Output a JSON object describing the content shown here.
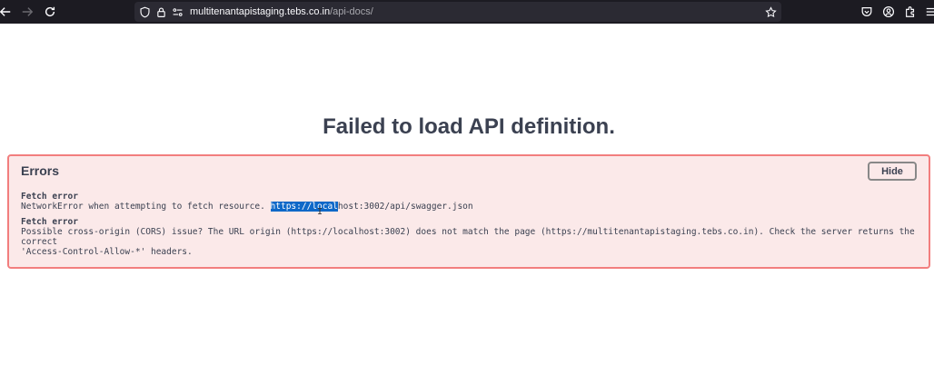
{
  "browser": {
    "url_host": "multitenantapistaging.tebs.co.in",
    "url_path": "/api-docs/"
  },
  "page": {
    "title": "Failed to load API definition."
  },
  "errors": {
    "heading": "Errors",
    "hide_label": "Hide",
    "items": [
      {
        "title": "Fetch error",
        "message_prefix": "NetworkError when attempting to fetch resource. ",
        "message_selected": "https://local",
        "message_suffix": "host:3002/api/swagger.json"
      },
      {
        "title": "Fetch error",
        "message": "Possible cross-origin (CORS) issue? The URL origin (https://localhost:3002) does not match the page (https://multitenantapistaging.tebs.co.in). Check the server returns the correct\n'Access-Control-Allow-*' headers."
      }
    ]
  },
  "colors": {
    "panel_background": "#fbe9e9",
    "panel_border": "#f27e7e",
    "text": "#3b4151",
    "selection": "#0e68c8"
  }
}
